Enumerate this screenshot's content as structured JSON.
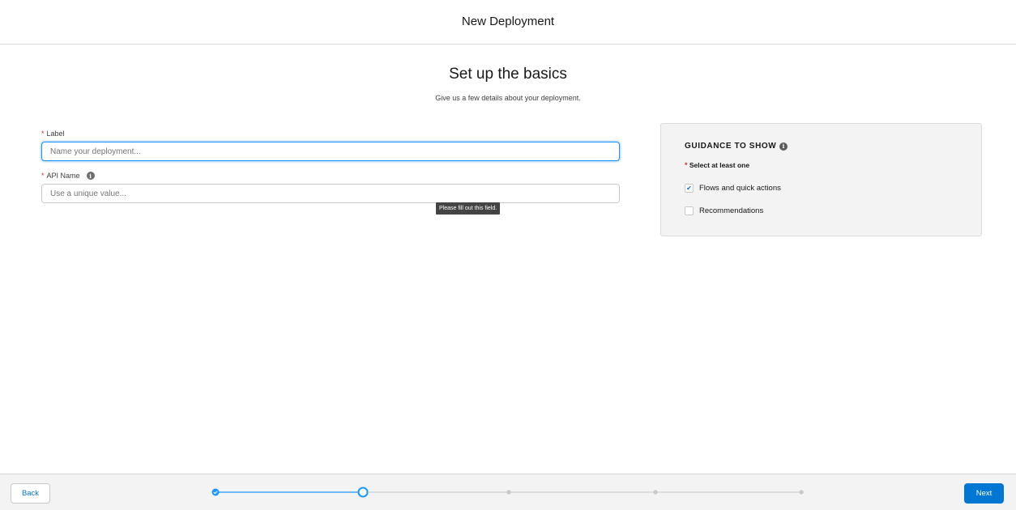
{
  "header": {
    "title": "New Deployment"
  },
  "hero": {
    "title": "Set up the basics",
    "subtitle": "Give us a few details about your deployment."
  },
  "form": {
    "label_field": {
      "required_mark": "*",
      "label": "Label",
      "placeholder": "Name your deployment...",
      "value": ""
    },
    "api_name_field": {
      "required_mark": "*",
      "label": "API Name",
      "placeholder": "Use a unique value...",
      "value": "",
      "info_icon": "info-icon"
    },
    "tooltip": "Please fill out this field."
  },
  "guidance": {
    "title": "GUIDANCE TO SHOW",
    "required_mark": "*",
    "required_text": "Select at least one",
    "options": [
      {
        "label": "Flows and quick actions",
        "checked": true
      },
      {
        "label": "Recommendations",
        "checked": false
      }
    ]
  },
  "footer": {
    "back_label": "Back",
    "next_label": "Next",
    "progress": {
      "total_steps": 5,
      "current_step": 2,
      "completed_steps": 1
    }
  },
  "colors": {
    "accent": "#0176d3",
    "progress_active": "#1b96ff",
    "required": "#c23934"
  }
}
